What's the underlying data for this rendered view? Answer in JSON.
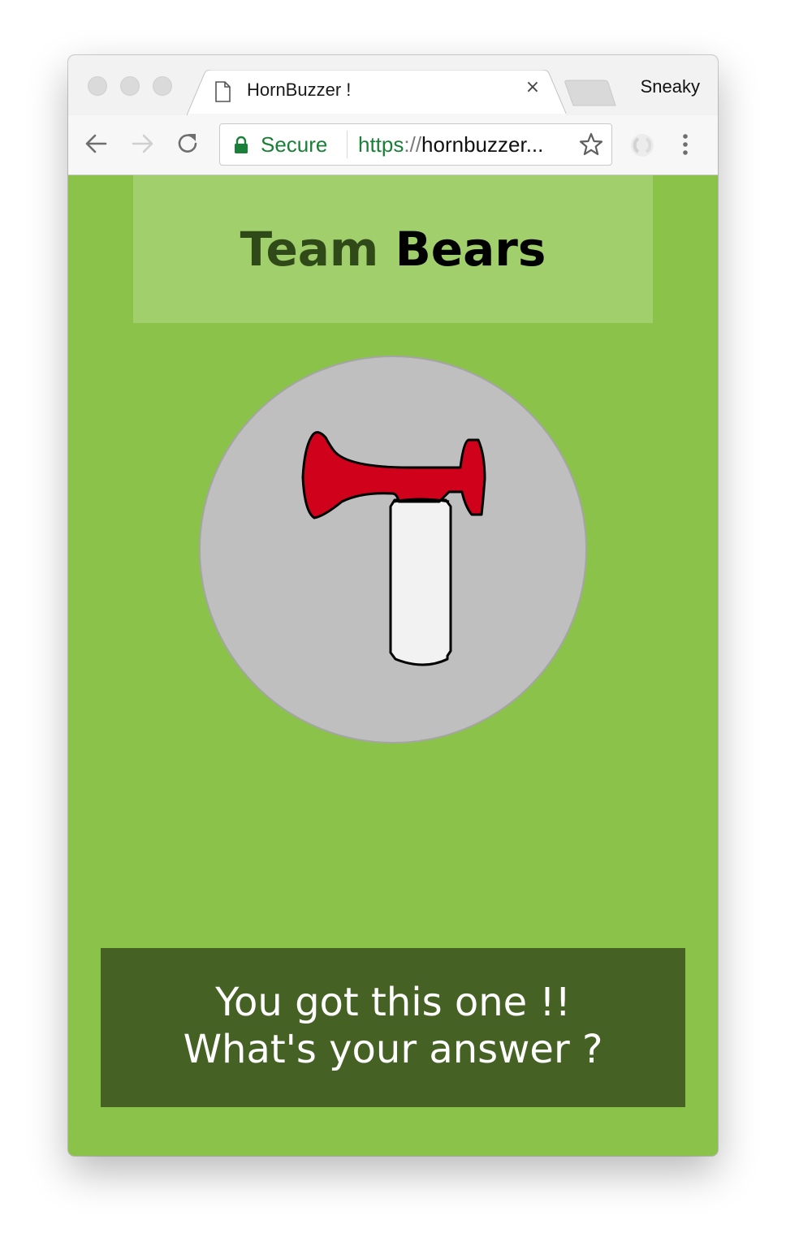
{
  "browser": {
    "tab_title": "HornBuzzer !",
    "tab_close_glyph": "×",
    "profile_name": "Sneaky",
    "security_label": "Secure",
    "url_scheme": "https",
    "url_separator": "://",
    "url_host": "hornbuzzer...",
    "icons": [
      "back-icon",
      "forward-icon",
      "reload-icon",
      "lock-icon",
      "star-icon",
      "extension-icon",
      "menu-icon",
      "page-icon"
    ]
  },
  "page": {
    "team_prefix": "Team",
    "team_name": "Bears",
    "buzzer_icon": "air-horn-icon",
    "message_line1": "You got this one !!",
    "message_line2": "What's your answer ?",
    "colors": {
      "background": "#8bc24a",
      "header": "#a1cf6b",
      "message_box": "#456224",
      "buzzer_circle": "#bfbfbf",
      "horn_red": "#d0021b"
    }
  }
}
